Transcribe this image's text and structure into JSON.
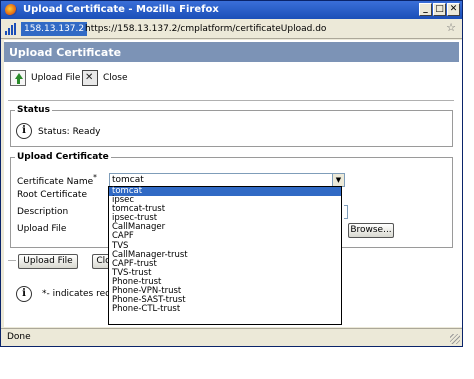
{
  "window": {
    "title": "Upload Certificate - Mozilla Firefox",
    "controls": {
      "minimize": "_",
      "maximize": "□",
      "close": "✕"
    }
  },
  "address": {
    "host_badge": "158.13.137.2",
    "url": "https://158.13.137.2/cmplatform/certificateUpload.do",
    "star_icon": "☆"
  },
  "page": {
    "heading": "Upload Certificate",
    "toolbar": {
      "upload_label": "Upload File",
      "close_label": "Close"
    }
  },
  "status": {
    "legend": "Status",
    "text": "Status: Ready",
    "icon": "i"
  },
  "form": {
    "legend": "Upload Certificate",
    "cert_name_label": "Certificate Name",
    "required_mark": "*",
    "root_cert_label": "Root Certificate",
    "description_label": "Description",
    "upload_file_label": "Upload File",
    "cert_name_value": "tomcat",
    "arrow": "▼",
    "browse_label": "Browse..."
  },
  "dropdown": {
    "options": [
      "tomcat",
      "ipsec",
      "tomcat-trust",
      "ipsec-trust",
      "CallManager",
      "CAPF",
      "TVS",
      "CallManager-trust",
      "CAPF-trust",
      "TVS-trust",
      "Phone-trust",
      "Phone-VPN-trust",
      "Phone-SAST-trust",
      "Phone-CTL-trust"
    ],
    "selected_index": 0
  },
  "bottom": {
    "upload_label": "Upload File",
    "close_partial": "Clo",
    "note_icon": "i",
    "required_note": "*- indicates requ"
  },
  "statusbar": {
    "text": "Done"
  }
}
